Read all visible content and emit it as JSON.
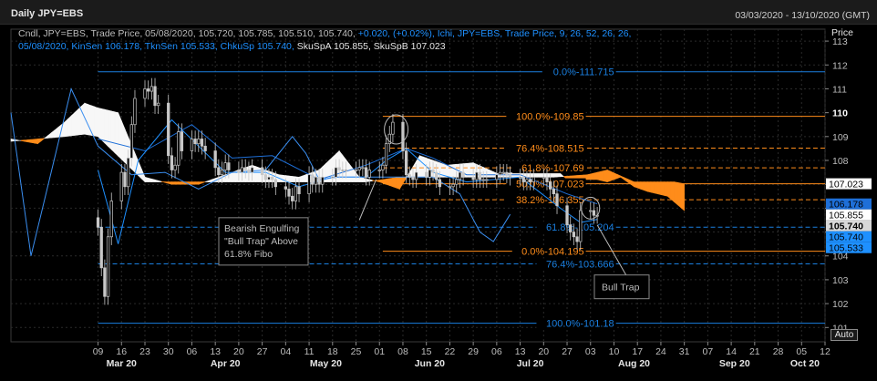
{
  "header": {
    "title": "Daily JPY=EBS",
    "date_range": "03/03/2020 - 13/10/2020 (GMT)"
  },
  "legend": {
    "line1_a": "Cndl, JPY=EBS, Trade Price, 05/08/2020, 105.720, 105.785, 105.510, 105.740, ",
    "line1_b": "+0.020, (+0.02%)",
    "line1_c": ", Ichi, JPY=EBS, Trade Price,  9, 26, 52, 26, 26,",
    "line2_a": "05/08/2020, KinSen 106.178, TknSen 105.533, ChkuSp 105.740, ",
    "line2_b": "SkuSpA 105.855, SkuSpB 107.023"
  },
  "axis": {
    "price_label": "Price",
    "auto_label": "Auto"
  },
  "annotations": {
    "bearish_line1": "Bearish Engulfing",
    "bearish_line2": "\"Bull Trap\" Above",
    "bearish_line3": "61.8% Fibo",
    "bull_trap": "Bull Trap"
  },
  "colors": {
    "background": "#000000",
    "grid": "#2a2a2a",
    "candle": "#c8c8c8",
    "kinsen": "#1e6fd8",
    "tenkan": "#1e90ff",
    "cloud_bull": "#f7f7f7",
    "cloud_bear": "#ff8c1a",
    "fib_blue": "#1a7fe0",
    "fib_orange": "#ff8c1a",
    "axis_text": "#bdbdbd",
    "label_box_border": "#888888"
  },
  "chart_data": {
    "type": "candlestick",
    "title": "Daily JPY=EBS",
    "ylim": [
      100.4,
      113.5
    ],
    "y_ticks": [
      101,
      102,
      103,
      104,
      105,
      106,
      107,
      108,
      109,
      110,
      111,
      112,
      113
    ],
    "y_tick_bold": [
      110
    ],
    "x_ticks": [
      {
        "label": "09",
        "day": 0
      },
      {
        "label": "16",
        "day": 7
      },
      {
        "label": "23",
        "day": 14
      },
      {
        "label": "30",
        "day": 21
      },
      {
        "label": "06",
        "day": 28
      },
      {
        "label": "13",
        "day": 35
      },
      {
        "label": "20",
        "day": 42
      },
      {
        "label": "27",
        "day": 49
      },
      {
        "label": "04",
        "day": 56
      },
      {
        "label": "11",
        "day": 63
      },
      {
        "label": "18",
        "day": 70
      },
      {
        "label": "25",
        "day": 77
      },
      {
        "label": "01",
        "day": 84
      },
      {
        "label": "08",
        "day": 91
      },
      {
        "label": "15",
        "day": 98
      },
      {
        "label": "22",
        "day": 105
      },
      {
        "label": "29",
        "day": 112
      },
      {
        "label": "06",
        "day": 119
      },
      {
        "label": "13",
        "day": 126
      },
      {
        "label": "20",
        "day": 133
      },
      {
        "label": "27",
        "day": 140
      },
      {
        "label": "03",
        "day": 147
      },
      {
        "label": "10",
        "day": 154
      },
      {
        "label": "17",
        "day": 161
      },
      {
        "label": "24",
        "day": 168
      },
      {
        "label": "31",
        "day": 175
      },
      {
        "label": "07",
        "day": 182
      },
      {
        "label": "14",
        "day": 189
      },
      {
        "label": "21",
        "day": 196
      },
      {
        "label": "28",
        "day": 203
      },
      {
        "label": "05",
        "day": 210
      },
      {
        "label": "12",
        "day": 217
      }
    ],
    "months": [
      {
        "label": "Mar 20",
        "day": 7
      },
      {
        "label": "Apr 20",
        "day": 38
      },
      {
        "label": "May 20",
        "day": 68
      },
      {
        "label": "Jun 20",
        "day": 99
      },
      {
        "label": "Jul 20",
        "day": 129
      },
      {
        "label": "Aug 20",
        "day": 160
      },
      {
        "label": "Sep 20",
        "day": 190
      },
      {
        "label": "Oct 20",
        "day": 211
      }
    ],
    "close_series": [
      [
        0,
        105.2
      ],
      [
        1,
        103.5
      ],
      [
        2,
        102.3
      ],
      [
        3,
        104.8
      ],
      [
        4,
        106.3
      ],
      [
        7,
        107.5
      ],
      [
        8,
        106.9
      ],
      [
        9,
        108.1
      ],
      [
        10,
        109.5
      ],
      [
        11,
        110.6
      ],
      [
        14,
        111.0
      ],
      [
        15,
        110.9
      ],
      [
        16,
        111.1
      ],
      [
        17,
        110.3
      ],
      [
        18,
        110.4
      ],
      [
        21,
        108.2
      ],
      [
        22,
        107.6
      ],
      [
        23,
        107.8
      ],
      [
        24,
        109.2
      ],
      [
        25,
        108.4
      ],
      [
        28,
        108.9
      ],
      [
        29,
        108.7
      ],
      [
        30,
        108.9
      ],
      [
        31,
        108.6
      ],
      [
        32,
        108.4
      ],
      [
        35,
        107.7
      ],
      [
        36,
        107.4
      ],
      [
        37,
        107.6
      ],
      [
        38,
        107.9
      ],
      [
        39,
        107.6
      ],
      [
        42,
        107.5
      ],
      [
        43,
        107.7
      ],
      [
        44,
        107.6
      ],
      [
        45,
        107.5
      ],
      [
        46,
        107.7
      ],
      [
        49,
        107.4
      ],
      [
        50,
        107.2
      ],
      [
        51,
        107.3
      ],
      [
        52,
        107.2
      ],
      [
        53,
        106.9
      ],
      [
        56,
        106.8
      ],
      [
        57,
        106.5
      ],
      [
        58,
        106.3
      ],
      [
        59,
        106.9
      ],
      [
        60,
        106.6
      ],
      [
        63,
        107.4
      ],
      [
        64,
        107.0
      ],
      [
        65,
        107.3
      ],
      [
        66,
        107.0
      ],
      [
        67,
        107.3
      ],
      [
        70,
        107.3
      ],
      [
        71,
        107.7
      ],
      [
        72,
        107.6
      ],
      [
        73,
        107.6
      ],
      [
        74,
        107.6
      ],
      [
        77,
        107.6
      ],
      [
        78,
        107.7
      ],
      [
        79,
        107.7
      ],
      [
        80,
        107.3
      ],
      [
        81,
        107.6
      ],
      [
        84,
        107.6
      ],
      [
        85,
        107.8
      ],
      [
        86,
        108.7
      ],
      [
        87,
        109.1
      ],
      [
        88,
        109.6
      ],
      [
        91,
        108.4
      ],
      [
        92,
        107.4
      ],
      [
        93,
        107.3
      ],
      [
        94,
        107.2
      ],
      [
        95,
        107.5
      ],
      [
        98,
        107.3
      ],
      [
        99,
        107.6
      ],
      [
        100,
        107.5
      ],
      [
        101,
        107.2
      ],
      [
        102,
        106.9
      ],
      [
        105,
        106.9
      ],
      [
        106,
        107.0
      ],
      [
        107,
        107.2
      ],
      [
        108,
        107.5
      ],
      [
        109,
        107.3
      ],
      [
        112,
        107.2
      ],
      [
        113,
        107.5
      ],
      [
        114,
        107.2
      ],
      [
        115,
        107.2
      ],
      [
        116,
        107.2
      ],
      [
        119,
        107.4
      ],
      [
        120,
        107.5
      ],
      [
        121,
        107.5
      ],
      [
        122,
        107.4
      ],
      [
        123,
        107.3
      ],
      [
        126,
        107.3
      ],
      [
        127,
        107.1
      ],
      [
        128,
        107.2
      ],
      [
        129,
        107.1
      ],
      [
        130,
        107.3
      ],
      [
        133,
        107.3
      ],
      [
        134,
        107.1
      ],
      [
        135,
        106.8
      ],
      [
        136,
        106.6
      ],
      [
        137,
        106.1
      ],
      [
        140,
        105.3
      ],
      [
        141,
        105.0
      ],
      [
        142,
        104.8
      ],
      [
        143,
        104.6
      ],
      [
        144,
        105.9
      ],
      [
        147,
        105.9
      ],
      [
        148,
        105.7
      ],
      [
        149,
        105.7
      ]
    ],
    "series": [
      {
        "name": "KinSen",
        "values": [
          [
            0,
            108.9
          ],
          [
            14,
            108.4
          ],
          [
            28,
            109.5
          ],
          [
            40,
            108.1
          ],
          [
            52,
            108.2
          ],
          [
            66,
            107.2
          ],
          [
            80,
            107.8
          ],
          [
            92,
            108.5
          ],
          [
            100,
            108.1
          ],
          [
            110,
            107.4
          ],
          [
            126,
            107.4
          ],
          [
            140,
            106.6
          ],
          [
            149,
            106.18
          ]
        ]
      },
      {
        "name": "TknSen",
        "values": [
          [
            0,
            107.6
          ],
          [
            6,
            104.5
          ],
          [
            12,
            108.0
          ],
          [
            22,
            109.7
          ],
          [
            30,
            108.6
          ],
          [
            38,
            107.5
          ],
          [
            50,
            107.5
          ],
          [
            60,
            106.9
          ],
          [
            70,
            107.3
          ],
          [
            80,
            107.3
          ],
          [
            86,
            108.0
          ],
          [
            92,
            108.5
          ],
          [
            100,
            107.5
          ],
          [
            110,
            107.1
          ],
          [
            126,
            107.3
          ],
          [
            138,
            106.0
          ],
          [
            144,
            105.4
          ],
          [
            149,
            105.53
          ]
        ]
      },
      {
        "name": "ChkuSp",
        "values": [
          [
            -26,
            110.0
          ],
          [
            -20,
            104.0
          ],
          [
            -14,
            107.5
          ],
          [
            -8,
            111.0
          ],
          [
            0,
            108.6
          ],
          [
            10,
            107.4
          ],
          [
            20,
            107.5
          ],
          [
            30,
            106.8
          ],
          [
            40,
            107.5
          ],
          [
            50,
            107.6
          ],
          [
            58,
            109.0
          ],
          [
            62,
            108.3
          ],
          [
            66,
            107.2
          ],
          [
            72,
            107.3
          ],
          [
            80,
            107.3
          ],
          [
            90,
            107.3
          ],
          [
            100,
            107.3
          ],
          [
            108,
            106.6
          ],
          [
            114,
            105.0
          ],
          [
            118,
            104.6
          ],
          [
            123,
            105.74
          ]
        ]
      },
      {
        "name": "SkuSpA",
        "values": [
          [
            -26,
            108.9
          ],
          [
            -18,
            108.7
          ],
          [
            -10,
            109.6
          ],
          [
            -4,
            110.4
          ],
          [
            0,
            110.2
          ],
          [
            6,
            110.0
          ],
          [
            14,
            107.3
          ],
          [
            22,
            107.0
          ],
          [
            30,
            107.0
          ],
          [
            38,
            107.4
          ],
          [
            46,
            107.8
          ],
          [
            54,
            107.4
          ],
          [
            60,
            107.3
          ],
          [
            66,
            107.6
          ],
          [
            72,
            108.4
          ],
          [
            78,
            107.3
          ],
          [
            84,
            107.1
          ],
          [
            90,
            106.8
          ],
          [
            96,
            108.2
          ],
          [
            104,
            107.8
          ],
          [
            112,
            107.9
          ],
          [
            120,
            107.4
          ],
          [
            128,
            107.6
          ],
          [
            136,
            107.7
          ],
          [
            140,
            107.2
          ],
          [
            146,
            107.2
          ],
          [
            149,
            107.2
          ],
          [
            152,
            107.1
          ],
          [
            156,
            107.3
          ],
          [
            158,
            107.1
          ],
          [
            160,
            106.9
          ],
          [
            164,
            106.7
          ],
          [
            170,
            106.5
          ],
          [
            175,
            105.9
          ]
        ]
      },
      {
        "name": "SkuSpB",
        "values": [
          [
            -26,
            108.8
          ],
          [
            -10,
            109.0
          ],
          [
            -4,
            109.1
          ],
          [
            0,
            109.0
          ],
          [
            14,
            107.1
          ],
          [
            30,
            107.1
          ],
          [
            40,
            107.1
          ],
          [
            56,
            107.1
          ],
          [
            70,
            107.1
          ],
          [
            80,
            107.1
          ],
          [
            90,
            107.3
          ],
          [
            96,
            107.3
          ],
          [
            112,
            107.3
          ],
          [
            120,
            107.3
          ],
          [
            128,
            107.3
          ],
          [
            136,
            107.3
          ],
          [
            146,
            107.4
          ],
          [
            152,
            107.6
          ],
          [
            160,
            107.1
          ],
          [
            164,
            107.1
          ],
          [
            168,
            107.1
          ],
          [
            172,
            107.1
          ],
          [
            175,
            107.02
          ]
        ]
      }
    ],
    "fib_levels": [
      {
        "label": "0.0% - 111.715",
        "price": 111.715,
        "color": "blue",
        "style": "solid",
        "day_from": 0
      },
      {
        "label": "61.8% - 105.204",
        "price": 105.204,
        "color": "blue",
        "style": "dashed",
        "day_from": 0
      },
      {
        "label": "76.4% - 103.666",
        "price": 103.666,
        "color": "blue",
        "style": "dashed",
        "day_from": 0
      },
      {
        "label": "100.0% - 101.18",
        "price": 101.18,
        "color": "blue",
        "style": "solid",
        "day_from": 0
      },
      {
        "label": "100.0% - 109.85",
        "price": 109.85,
        "color": "orange",
        "style": "solid",
        "day_from": 85
      },
      {
        "label": "76.4% - 108.515",
        "price": 108.515,
        "color": "orange",
        "style": "dashed",
        "day_from": 85
      },
      {
        "label": "61.8% - 107.69",
        "price": 107.69,
        "color": "orange",
        "style": "dashed",
        "day_from": 85
      },
      {
        "label": "50.0% - 107.023",
        "price": 107.023,
        "color": "orange",
        "style": "solid",
        "day_from": 85
      },
      {
        "label": "38.2% - 106.355",
        "price": 106.355,
        "color": "orange",
        "style": "dashed",
        "day_from": 85
      },
      {
        "label": "0.0% - 104.195",
        "price": 104.195,
        "color": "orange",
        "style": "solid",
        "day_from": 85
      }
    ],
    "price_tags": [
      {
        "value": "107.023",
        "bg": "#ffffff",
        "fg": "#000000",
        "price": 107.023
      },
      {
        "value": "106.178",
        "bg": "#1e6fd8",
        "fg": "#000000",
        "price": 106.178
      },
      {
        "value": "105.855",
        "bg": "#ffffff",
        "fg": "#000000",
        "price": 105.855
      },
      {
        "value": "105.740",
        "bg": "#d8d8d8",
        "fg": "#000000",
        "price": 105.74,
        "bold": true
      },
      {
        "value": "105.740",
        "bg": "#1e90ff",
        "fg": "#000000",
        "price": 105.74
      },
      {
        "value": "105.533",
        "bg": "#1e90ff",
        "fg": "#000000",
        "price": 105.533
      }
    ]
  }
}
